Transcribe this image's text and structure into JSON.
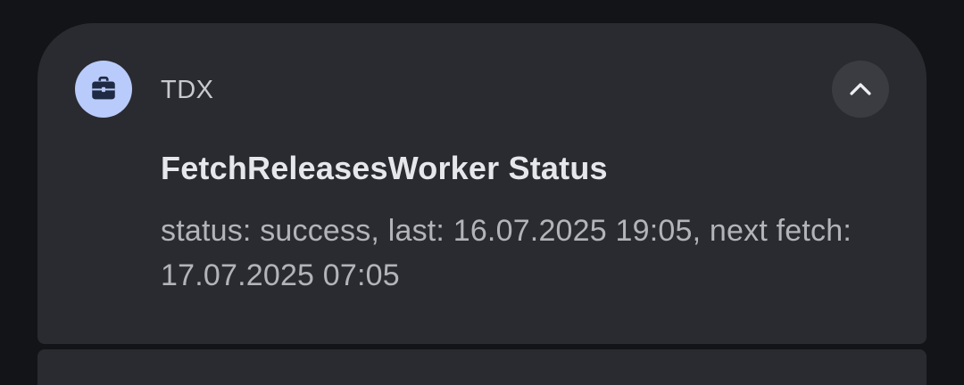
{
  "notification": {
    "app_name": "TDX",
    "app_icon": "briefcase-icon",
    "title": "FetchReleasesWorker Status",
    "body": "status: success, last: 16.07.2025 19:05, next fetch: 17.07.2025 07:05",
    "collapse_icon": "chevron-up-icon"
  },
  "colors": {
    "background": "#131418",
    "card": "#2a2b30",
    "icon_bg": "#b9cbfb",
    "icon_fg": "#1f2a44",
    "collapse_bg": "#3b3c42",
    "title_text": "#e6e7eb",
    "body_text": "#b3b4ba"
  }
}
